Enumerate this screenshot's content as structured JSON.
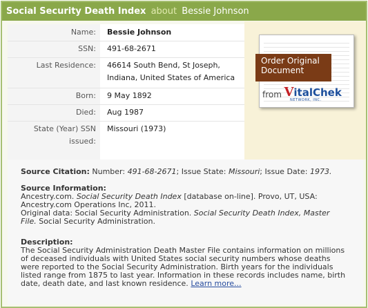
{
  "title": {
    "main": "Social Security Death Index",
    "about": "about",
    "name": "Bessie Johnson"
  },
  "record": {
    "name_label": "Name:",
    "name": "Bessie Johnson",
    "ssn_label": "SSN:",
    "ssn": "491-68-2671",
    "residence_label": "Last Residence:",
    "residence_line1": "46614  South Bend, St Joseph,",
    "residence_line2": "Indiana, United States of America",
    "born_label": "Born:",
    "born": "9 May 1892",
    "died_label": "Died:",
    "died": "Aug 1987",
    "state_label_line1": "State (Year) SSN",
    "state_label_line2": "issued:",
    "state": "Missouri (1973)"
  },
  "order": {
    "line1": "Order Original",
    "line2": "Document",
    "from": "from",
    "brand_v": "V",
    "brand_rest": "italChek",
    "brand_sub": "NETWORK, INC."
  },
  "citation": {
    "heading": "Source Citation:",
    "number_label": "Number:",
    "number": "491-68-2671",
    "issue_state_label": "Issue State:",
    "issue_state": "Missouri",
    "issue_date_label": "Issue Date:",
    "issue_date": "1973."
  },
  "source": {
    "heading": "Source Information:",
    "line1_a": "Ancestry.com.",
    "line1_b": "Social Security Death Index",
    "line1_c": "[database on-line]. Provo, UT, USA:",
    "line2": "Ancestry.com Operations Inc, 2011.",
    "line3_a": "Original data: Social Security Administration.",
    "line3_b": "Social Security Death Index, Master",
    "line4_a": "File.",
    "line4_b": "Social Security Administration."
  },
  "description": {
    "heading": "Description:",
    "line1": "The Social Security Administration Death Master File contains information on millions",
    "line2": "of deceased individuals with United States social security numbers whose deaths",
    "line3": "were reported to the Social Security Administration. Birth years for the individuals",
    "line4": "listed range from 1875 to last year. Information in these records includes name, birth",
    "line5": "date, death date, and last known residence.",
    "learn_more": "Learn more..."
  },
  "colors": {
    "titlebar": "#8aa84a",
    "frame_border": "#a6bf72",
    "order_banner": "#7a3b16",
    "link": "#264b9e"
  }
}
